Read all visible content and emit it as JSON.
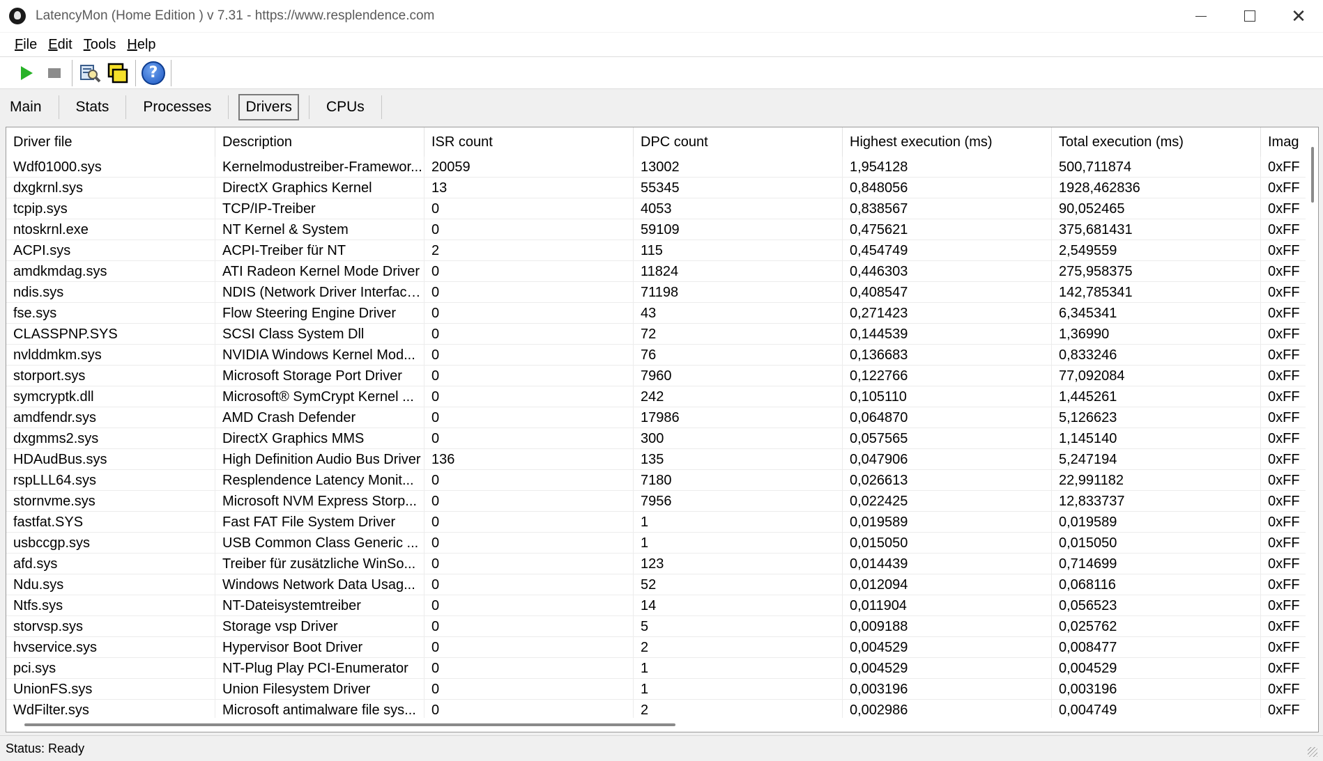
{
  "window": {
    "title": "LatencyMon  (Home Edition )  v 7.31 - https://www.resplendence.com"
  },
  "menu": [
    {
      "first": "F",
      "rest": "ile"
    },
    {
      "first": "E",
      "rest": "dit"
    },
    {
      "first": "T",
      "rest": "ools"
    },
    {
      "first": "H",
      "rest": "elp"
    }
  ],
  "toolbar": {
    "icons": [
      "play-icon",
      "stop-icon",
      "search-icon",
      "windows-icon",
      "help-icon"
    ],
    "help_glyph": "?"
  },
  "tabs": [
    "Main",
    "Stats",
    "Processes",
    "Drivers",
    "CPUs"
  ],
  "active_tab": "Drivers",
  "table": {
    "columns": [
      "Driver file",
      "Description",
      "ISR count",
      "DPC count",
      "Highest execution (ms)",
      "Total execution (ms)",
      "Imag"
    ],
    "rows": [
      [
        "Wdf01000.sys",
        "Kernelmodustreiber-Framewor...",
        "20059",
        "13002",
        "1,954128",
        "500,711874",
        "0xFF"
      ],
      [
        "dxgkrnl.sys",
        "DirectX Graphics Kernel",
        "13",
        "55345",
        "0,848056",
        "1928,462836",
        "0xFF"
      ],
      [
        "tcpip.sys",
        "TCP/IP-Treiber",
        "0",
        "4053",
        "0,838567",
        "90,052465",
        "0xFF"
      ],
      [
        "ntoskrnl.exe",
        "NT Kernel & System",
        "0",
        "59109",
        "0,475621",
        "375,681431",
        "0xFF"
      ],
      [
        "ACPI.sys",
        "ACPI-Treiber für NT",
        "2",
        "115",
        "0,454749",
        "2,549559",
        "0xFF"
      ],
      [
        "amdkmdag.sys",
        "ATI Radeon Kernel Mode Driver",
        "0",
        "11824",
        "0,446303",
        "275,958375",
        "0xFF"
      ],
      [
        "ndis.sys",
        "NDIS (Network Driver Interface...",
        "0",
        "71198",
        "0,408547",
        "142,785341",
        "0xFF"
      ],
      [
        "fse.sys",
        "Flow Steering Engine Driver",
        "0",
        "43",
        "0,271423",
        "6,345341",
        "0xFF"
      ],
      [
        "CLASSPNP.SYS",
        "SCSI Class System Dll",
        "0",
        "72",
        "0,144539",
        "1,36990",
        "0xFF"
      ],
      [
        "nvlddmkm.sys",
        "NVIDIA Windows Kernel Mod...",
        "0",
        "76",
        "0,136683",
        "0,833246",
        "0xFF"
      ],
      [
        "storport.sys",
        "Microsoft Storage Port Driver",
        "0",
        "7960",
        "0,122766",
        "77,092084",
        "0xFF"
      ],
      [
        "symcryptk.dll",
        "Microsoft® SymCrypt Kernel ...",
        "0",
        "242",
        "0,105110",
        "1,445261",
        "0xFF"
      ],
      [
        "amdfendr.sys",
        "AMD Crash Defender",
        "0",
        "17986",
        "0,064870",
        "5,126623",
        "0xFF"
      ],
      [
        "dxgmms2.sys",
        "DirectX Graphics MMS",
        "0",
        "300",
        "0,057565",
        "1,145140",
        "0xFF"
      ],
      [
        "HDAudBus.sys",
        "High Definition Audio Bus Driver",
        "136",
        "135",
        "0,047906",
        "5,247194",
        "0xFF"
      ],
      [
        "rspLLL64.sys",
        "Resplendence Latency Monit...",
        "0",
        "7180",
        "0,026613",
        "22,991182",
        "0xFF"
      ],
      [
        "stornvme.sys",
        "Microsoft NVM Express Storp...",
        "0",
        "7956",
        "0,022425",
        "12,833737",
        "0xFF"
      ],
      [
        "fastfat.SYS",
        "Fast FAT File System Driver",
        "0",
        "1",
        "0,019589",
        "0,019589",
        "0xFF"
      ],
      [
        "usbccgp.sys",
        "USB Common Class Generic ...",
        "0",
        "1",
        "0,015050",
        "0,015050",
        "0xFF"
      ],
      [
        "afd.sys",
        "Treiber für zusätzliche WinSo...",
        "0",
        "123",
        "0,014439",
        "0,714699",
        "0xFF"
      ],
      [
        "Ndu.sys",
        "Windows Network Data Usag...",
        "0",
        "52",
        "0,012094",
        "0,068116",
        "0xFF"
      ],
      [
        "Ntfs.sys",
        "NT-Dateisystemtreiber",
        "0",
        "14",
        "0,011904",
        "0,056523",
        "0xFF"
      ],
      [
        "storvsp.sys",
        "Storage vsp Driver",
        "0",
        "5",
        "0,009188",
        "0,025762",
        "0xFF"
      ],
      [
        "hvservice.sys",
        "Hypervisor Boot Driver",
        "0",
        "2",
        "0,004529",
        "0,008477",
        "0xFF"
      ],
      [
        "pci.sys",
        "NT-Plug  Play PCI-Enumerator",
        "0",
        "1",
        "0,004529",
        "0,004529",
        "0xFF"
      ],
      [
        "UnionFS.sys",
        "Union Filesystem Driver",
        "0",
        "1",
        "0,003196",
        "0,003196",
        "0xFF"
      ],
      [
        "WdFilter.sys",
        "Microsoft antimalware file sys...",
        "0",
        "2",
        "0,002986",
        "0,004749",
        "0xFF"
      ]
    ]
  },
  "status": {
    "text": "Status: Ready"
  }
}
